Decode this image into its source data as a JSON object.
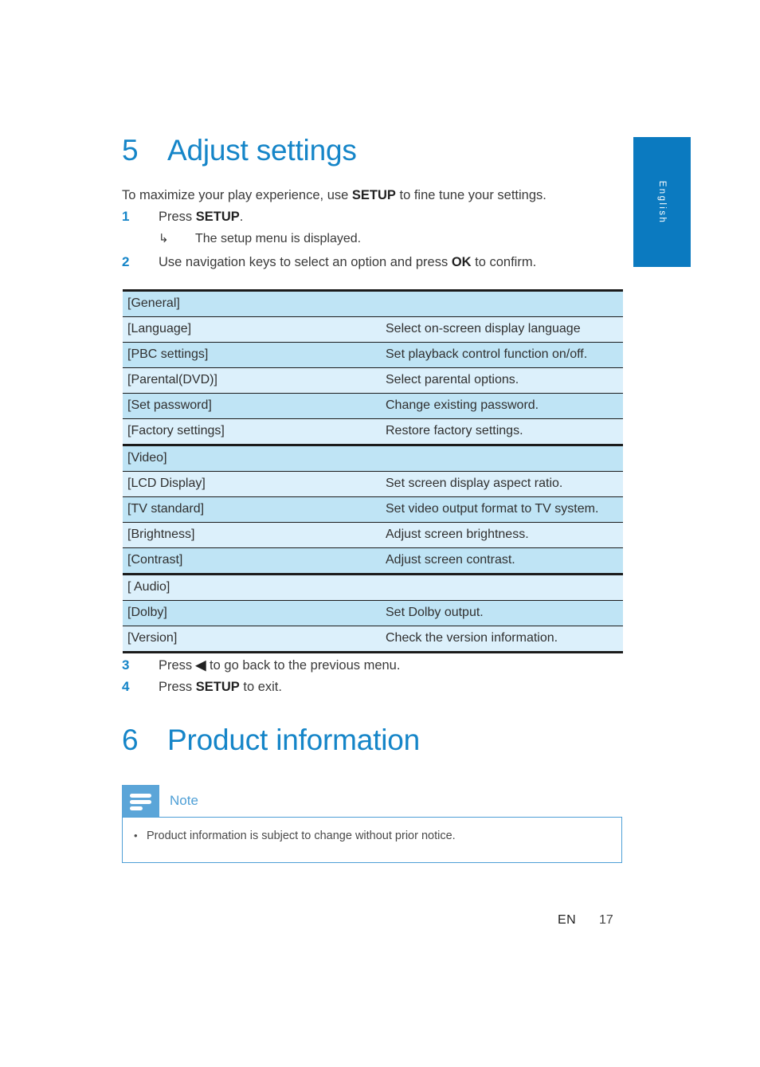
{
  "language_tab": {
    "label": "English"
  },
  "chapters": [
    {
      "number": "5",
      "title": "Adjust settings"
    },
    {
      "number": "6",
      "title": "Product information"
    }
  ],
  "intro": {
    "part1": "To maximize your play experience, use ",
    "bold": "SETUP",
    "part2": " to fine tune your settings."
  },
  "steps_top": [
    {
      "number": "1",
      "pre": "Press ",
      "bold": "SETUP",
      "post": "."
    },
    {
      "number": "2",
      "pre": "Use navigation keys to select an option and press ",
      "bold": "OK",
      "post": " to confirm."
    }
  ],
  "substep": {
    "arrow": "↳",
    "text": "The setup menu is displayed."
  },
  "steps_bottom": [
    {
      "number": "3",
      "pre": "Press ",
      "bold": "◀",
      "post": " to go back to the previous menu."
    },
    {
      "number": "4",
      "pre": "Press ",
      "bold": "SETUP",
      "post": " to exit."
    }
  ],
  "settings_table": {
    "rows": [
      {
        "option": "[General]",
        "description": "",
        "shade": "a",
        "section": true
      },
      {
        "option": "[Language]",
        "description": "Select on-screen display language",
        "shade": "b",
        "section": false
      },
      {
        "option": "[PBC settings]",
        "description": "Set playback control function on/off.",
        "shade": "a",
        "section": false
      },
      {
        "option": "[Parental(DVD)]",
        "description": "Select parental options.",
        "shade": "b",
        "section": false
      },
      {
        "option": "[Set password]",
        "description": "Change existing password.",
        "shade": "a",
        "section": false
      },
      {
        "option": "[Factory settings]",
        "description": "Restore factory settings.",
        "shade": "b",
        "section": false
      },
      {
        "option": "[Video]",
        "description": "",
        "shade": "a",
        "section": true
      },
      {
        "option": "[LCD Display]",
        "description": "Set screen display aspect ratio.",
        "shade": "b",
        "section": false
      },
      {
        "option": "[TV standard]",
        "description": "Set video output format to TV system.",
        "shade": "a",
        "section": false
      },
      {
        "option": "[Brightness]",
        "description": "Adjust screen brightness.",
        "shade": "b",
        "section": false
      },
      {
        "option": "[Contrast]",
        "description": "Adjust screen contrast.",
        "shade": "a",
        "section": false
      },
      {
        "option": "[ Audio]",
        "description": "",
        "shade": "b",
        "section": true
      },
      {
        "option": "[Dolby]",
        "description": "Set Dolby output.",
        "shade": "a",
        "section": false
      },
      {
        "option": "[Version]",
        "description": "Check the version information.",
        "shade": "b",
        "section": false
      }
    ]
  },
  "note": {
    "title": "Note",
    "icon": "note-lines-icon",
    "bullet": "•",
    "text": "Product information is subject to change without prior notice."
  },
  "footer": {
    "language_code": "EN",
    "page_number": "17"
  },
  "colors": {
    "accent_blue": "#1585C8",
    "tab_blue": "#0B7AC0",
    "note_blue": "#5BA5D8",
    "note_title_blue": "#4E9FD6",
    "row_shade_dark": "#BFE4F5",
    "row_shade_light": "#DCF0FB",
    "text": "#3a3a3a"
  }
}
